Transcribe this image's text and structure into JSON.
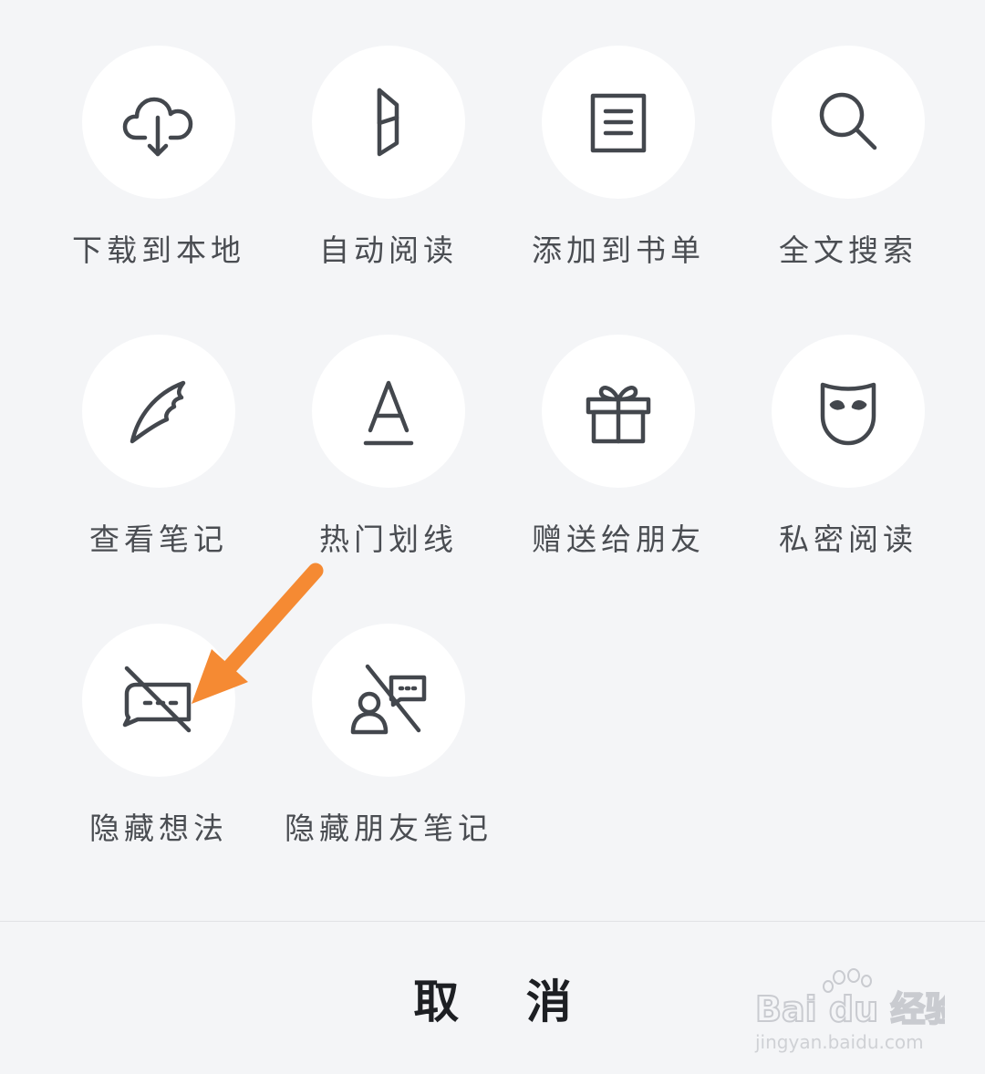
{
  "menu": {
    "items": [
      {
        "label": "下载到本地",
        "icon": "cloud-download-icon"
      },
      {
        "label": "自动阅读",
        "icon": "page-turn-icon"
      },
      {
        "label": "添加到书单",
        "icon": "book-list-icon"
      },
      {
        "label": "全文搜索",
        "icon": "search-icon"
      },
      {
        "label": "查看笔记",
        "icon": "quill-icon"
      },
      {
        "label": "热门划线",
        "icon": "underline-a-icon"
      },
      {
        "label": "赠送给朋友",
        "icon": "gift-icon"
      },
      {
        "label": "私密阅读",
        "icon": "mask-icon"
      },
      {
        "label": "隐藏想法",
        "icon": "hide-comment-icon"
      },
      {
        "label": "隐藏朋友笔记",
        "icon": "hide-friend-notes-icon"
      }
    ]
  },
  "cancel": {
    "label": "取 消"
  },
  "watermark": {
    "brand": "Bai du 经验",
    "url": "jingyan.baidu.com"
  },
  "colors": {
    "background": "#f4f5f7",
    "circle": "#ffffff",
    "icon": "#43474d",
    "label": "#4a4d52",
    "arrow": "#f58a33"
  }
}
